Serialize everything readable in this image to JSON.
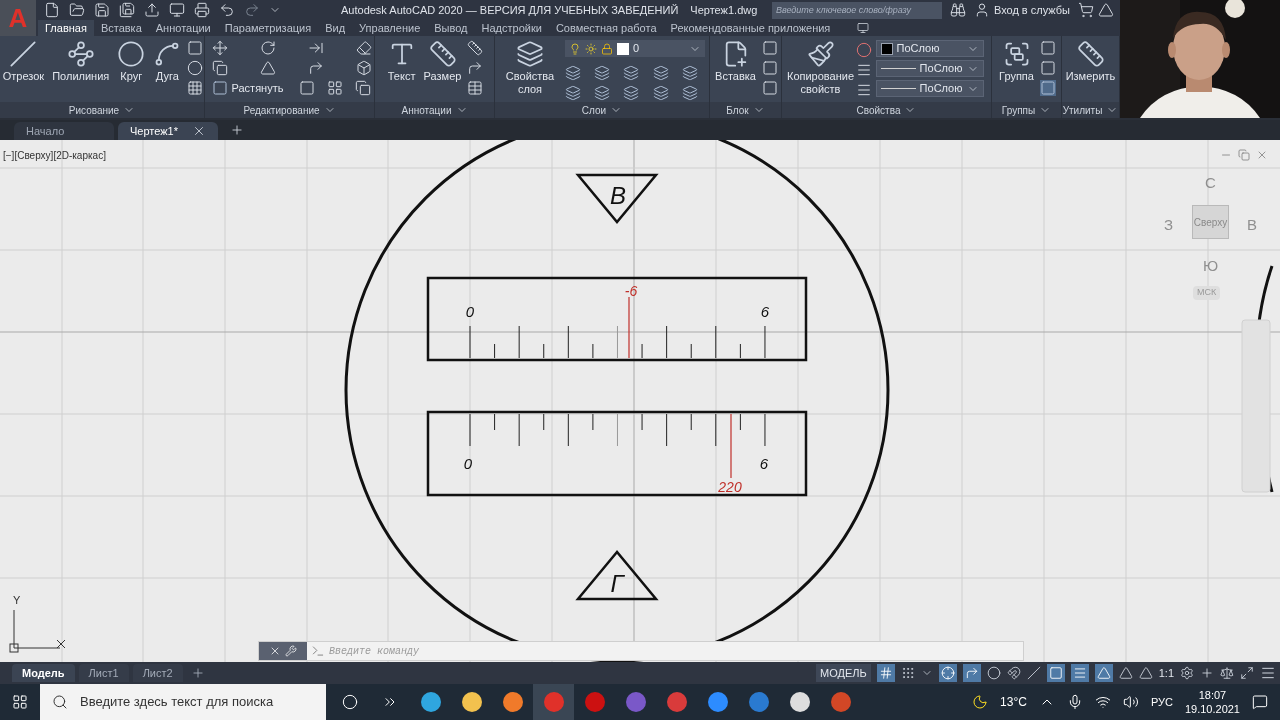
{
  "title_bar": {
    "logo": "A",
    "app_title": "Autodesk AutoCAD 2020 — ВЕРСИЯ ДЛЯ УЧЕБНЫХ ЗАВЕДЕНИЙ",
    "file_name": "Чертеж1.dwg",
    "search_placeholder": "Введите ключевое слово/фразу",
    "sign_in": "Вход в службы"
  },
  "ribbon_tabs": [
    {
      "label": "Главная",
      "selected": true
    },
    {
      "label": "Вставка",
      "selected": false
    },
    {
      "label": "Аннотации",
      "selected": false
    },
    {
      "label": "Параметризация",
      "selected": false
    },
    {
      "label": "Вид",
      "selected": false
    },
    {
      "label": "Управление",
      "selected": false
    },
    {
      "label": "Вывод",
      "selected": false
    },
    {
      "label": "Надстройки",
      "selected": false
    },
    {
      "label": "Совместная работа",
      "selected": false
    },
    {
      "label": "Рекомендованные приложения",
      "selected": false
    }
  ],
  "ribbon_panels": [
    {
      "title": "Рисование",
      "tools": [
        "Отрезок",
        "Полилиния",
        "Круг",
        "Дуга"
      ]
    },
    {
      "title": "Редактирование",
      "small_labeled_tool": "Растянуть"
    },
    {
      "title": "Аннотации",
      "tools": [
        "Текст",
        "Размер"
      ]
    },
    {
      "title": "Слои",
      "tools": [
        "Свойства слоя"
      ],
      "layer_dropdown": "0"
    },
    {
      "title": "Блок",
      "tools": [
        "Вставка"
      ]
    },
    {
      "title": "Свойства",
      "tools": [
        "Копирование свойств"
      ],
      "dropdowns": [
        "ПоСлою",
        "ПоСлою",
        "ПоСлою"
      ]
    },
    {
      "title": "Группы",
      "tools": [
        "Группа"
      ]
    },
    {
      "title": "Утилиты",
      "tools": [
        "Измерить"
      ]
    }
  ],
  "file_tabs": [
    {
      "label": "Начало",
      "selected": false
    },
    {
      "label": "Чертеж1*",
      "selected": true
    }
  ],
  "viewport": {
    "label": "[−][Сверху][2D-каркас]",
    "viewcube": {
      "north": "С",
      "west": "З",
      "face": "Сверху",
      "east": "В",
      "south": "Ю",
      "ucs": "МСК"
    },
    "axis_label": "Y",
    "command_placeholder": "Введите команду"
  },
  "drawing": {
    "top_letter": "В",
    "bottom_letter": "Г",
    "upper_scale": {
      "start": "0",
      "end": "6",
      "pointer": "-6"
    },
    "lower_scale": {
      "start": "0",
      "end": "6",
      "pointer": "220"
    }
  },
  "layout_tabs": [
    {
      "label": "Модель",
      "selected": true
    },
    {
      "label": "Лист1",
      "selected": false
    },
    {
      "label": "Лист2",
      "selected": false
    }
  ],
  "status_bar": {
    "space": "МОДЕЛЬ",
    "scale": "1:1"
  },
  "taskbar": {
    "search_placeholder": "Введите здесь текст для поиска",
    "temperature": "13°C",
    "language": "РУС",
    "time": "18:07",
    "date": "19.10.2021"
  }
}
